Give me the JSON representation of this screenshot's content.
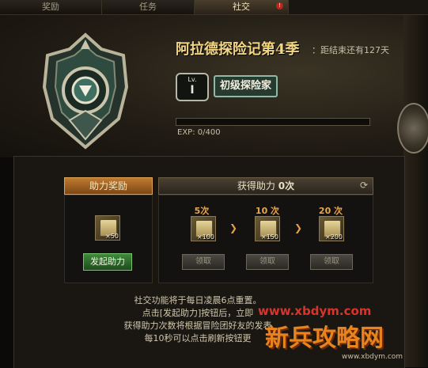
{
  "tabs": [
    {
      "label": "奖励",
      "active": false
    },
    {
      "label": "任务",
      "active": false
    },
    {
      "label": "社交",
      "active": true,
      "badge": "!"
    }
  ],
  "header": {
    "title": "阿拉德探险记第4季",
    "countdown": "：距结束还有127天",
    "level_prefix": "Lv.",
    "level": "I",
    "rank_title": "初级探险家",
    "exp_label": "EXP:",
    "exp_value": "0/400",
    "exp_progress": 0
  },
  "assist": {
    "left_header": "助力奖励",
    "right_header_prefix": "获得助力",
    "right_header_count": "0次",
    "self_item_count": "×50",
    "start_button": "发起助力",
    "tiers": [
      {
        "label": "5次",
        "count": "×100",
        "button": "领取"
      },
      {
        "label": "10 次",
        "count": "×150",
        "button": "领取"
      },
      {
        "label": "20 次",
        "count": "×200",
        "button": "领取"
      }
    ]
  },
  "info_lines": [
    "社交功能将于每日凌晨6点重置。",
    "点击[发起助力]按钮后，立即",
    "获得助力次数将根据冒险团好友的发表",
    "每10秒可以点击刷新按钮更"
  ],
  "watermark": {
    "url": "www.xbdym.com",
    "logo": "新兵攻略网",
    "url_small": "www.xbdym.com"
  },
  "colors": {
    "accent": "#f2d684",
    "tab_alert": "#b8281e",
    "start_button": "#3f8a3c",
    "tier_label": "#e8a74d"
  }
}
